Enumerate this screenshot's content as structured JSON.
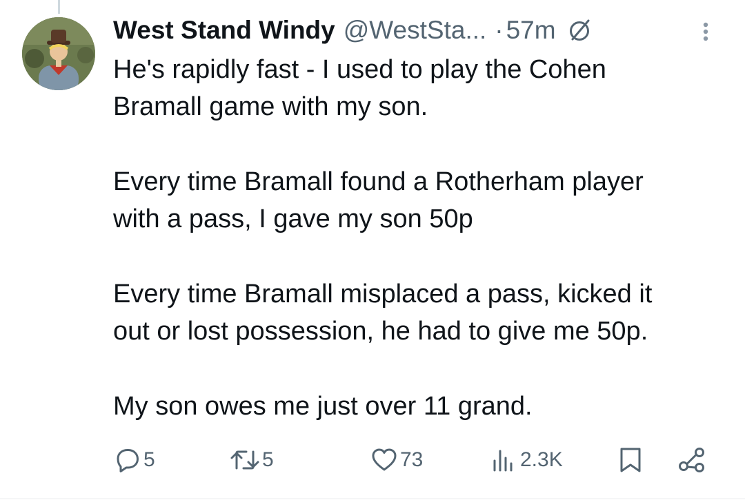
{
  "tweet": {
    "display_name": "West Stand Windy",
    "handle": "@WestSta...",
    "separator": "·",
    "time": "57m",
    "paragraphs": [
      [
        "He's rapidly fast - I used to play the Cohen",
        "Bramall game with my son."
      ],
      [
        "Every time Bramall found a Rotherham player",
        "with a pass, I gave my son 50p"
      ],
      [
        "Every time Bramall misplaced a pass, kicked it",
        "out or lost possession, he had to give me 50p."
      ],
      [
        "My son owes me just over 11 grand."
      ]
    ]
  },
  "actions": {
    "replies": "5",
    "reposts": "5",
    "likes": "73",
    "views": "2.3K"
  },
  "icons": {
    "reply": "reply-icon",
    "repost": "repost-icon",
    "like": "heart-icon",
    "views": "views-icon",
    "bookmark": "bookmark-icon",
    "share": "share-icon",
    "edited": "no-symbol-icon",
    "more": "more-icon"
  },
  "colors": {
    "text": "#0f1419",
    "secondary": "#536471",
    "divider": "#e6e9eb"
  }
}
